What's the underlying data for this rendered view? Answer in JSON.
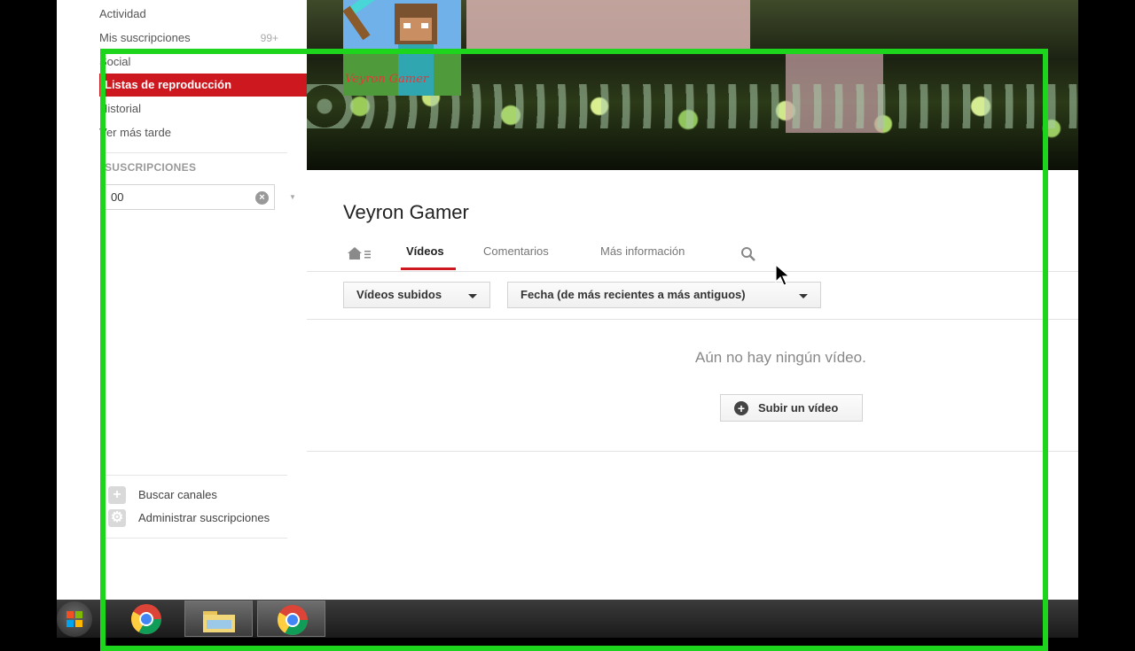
{
  "sidebar": {
    "items": [
      {
        "label": "Actividad",
        "count": ""
      },
      {
        "label": "Mis suscripciones",
        "count": "99+"
      },
      {
        "label": "Social",
        "count": ""
      },
      {
        "label": "Listas de reproducción",
        "count": ""
      },
      {
        "label": "Historial",
        "count": ""
      },
      {
        "label": "Ver más tarde",
        "count": ""
      }
    ],
    "active_item": "Listas de reproducción",
    "subscriptions_heading": "SUSCRIPCIONES",
    "search_value": "00",
    "actions": [
      {
        "label": "Buscar canales",
        "icon": "plus-icon"
      },
      {
        "label": "Administrar suscripciones",
        "icon": "gear-icon"
      }
    ]
  },
  "channel": {
    "avatar_text": "Veyron Gamer",
    "title": "Veyron Gamer",
    "tabs": [
      {
        "label": "Vídeos",
        "active": true
      },
      {
        "label": "Comentarios",
        "active": false
      },
      {
        "label": "Más información",
        "active": false
      }
    ]
  },
  "filters": {
    "type_label": "Vídeos subidos",
    "sort_label": "Fecha (de más recientes a más antiguos)"
  },
  "content": {
    "empty_message": "Aún no hay ningún vídeo.",
    "upload_label": "Subir un vídeo"
  },
  "taskbar": {
    "icons": [
      "windows-start-icon",
      "chrome-icon",
      "file-explorer-icon",
      "chrome-icon"
    ]
  },
  "colors": {
    "accent_red": "#cc181e",
    "frame_green": "#1ed51e"
  }
}
